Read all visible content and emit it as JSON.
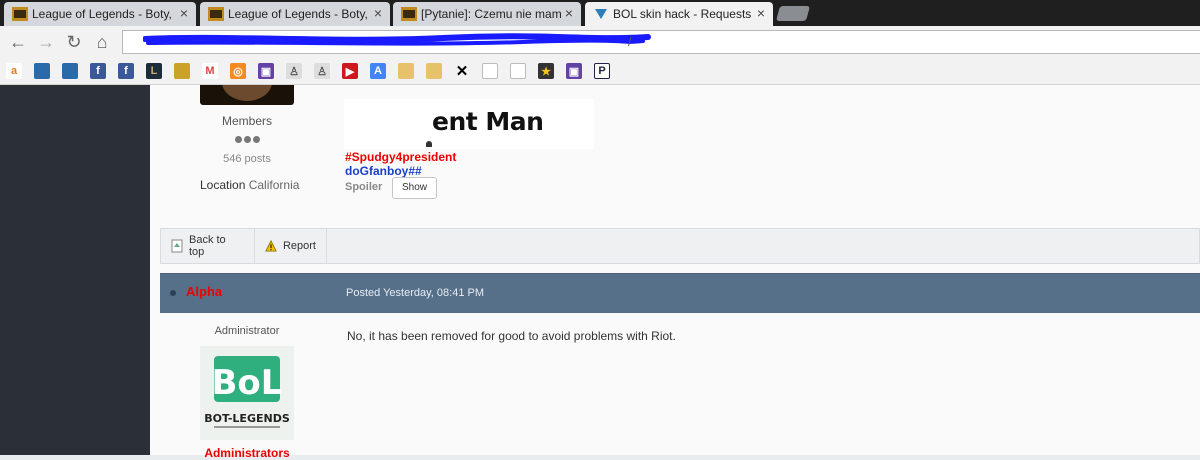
{
  "browser": {
    "tabs": [
      {
        "title": "League of Legends - Boty,",
        "close": "×"
      },
      {
        "title": "League of Legends - Boty,",
        "close": "×"
      },
      {
        "title": "[Pytanie]: Czemu nie mam",
        "close": "×"
      },
      {
        "title": "BOL skin hack - Requests",
        "close": "×"
      }
    ],
    "address_visible_text": "/",
    "bookmark_icons": [
      "amazon-icon",
      "sky-icon",
      "sky-icon",
      "facebook-icon",
      "facebook-icon",
      "league-icon",
      "crown-icon",
      "gmail-icon",
      "orange-icon",
      "twitch-icon",
      "figure-icon",
      "figure-icon",
      "youtube-icon",
      "translate-icon",
      "folder-icon",
      "folder-icon",
      "x-icon",
      "page-icon",
      "page-icon",
      "star-icon",
      "twitch-icon",
      "p-icon"
    ],
    "colors": {
      "tabstrip": "#1f1f1f",
      "accent_blue": "#1a1aff"
    }
  },
  "previous_post": {
    "member_group": "Members",
    "post_count": "546 posts",
    "location_label": "Location",
    "location_value": "California",
    "signature_text": "ent Man",
    "red_line": "#Spudgy4president",
    "blue_line": "doGfanboy##",
    "spoiler_label": "Spoiler",
    "show_button": "Show"
  },
  "actions": {
    "back_to_top": "Back to top",
    "report": "Report"
  },
  "post": {
    "author": "Alpha",
    "posted": "Posted Yesterday, 08:41 PM",
    "role": "Administrator",
    "message": "No, it has been removed for good to avoid problems with Riot.",
    "group": "Administrators",
    "logo_text_top": "BoL",
    "logo_text_bottom": "BOT-LEGENDS",
    "colors": {
      "header": "#56708a",
      "author": "#ee0000"
    }
  }
}
